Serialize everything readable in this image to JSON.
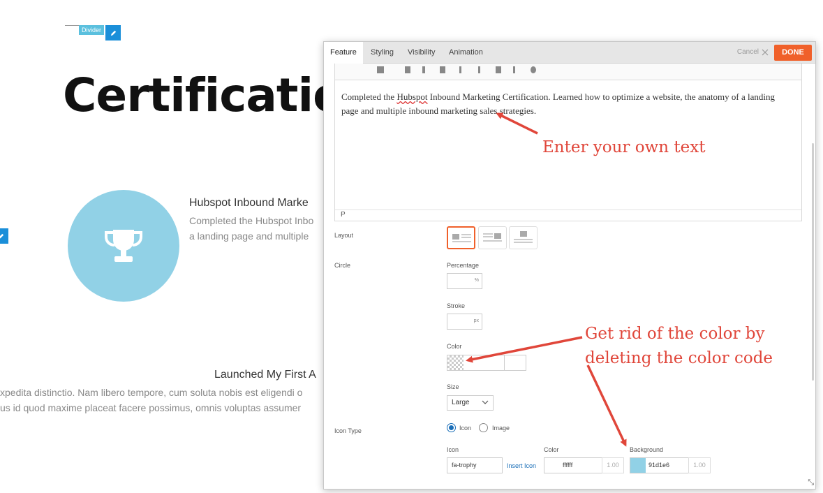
{
  "page": {
    "divider_tag": "Divider",
    "title": "Certificatio",
    "feature_title": "Hubspot Inbound Marke",
    "feature_desc_1": "Completed the Hubspot Inbo",
    "feature_desc_2": "a landing page and multiple",
    "launch_title": "Launched My First A",
    "lorem_1": "xpedita distinctio. Nam libero tempore, cum soluta nobis est eligendi o",
    "lorem_2": "us id quod maxime placeat facere possimus, omnis voluptas assumer",
    "circle_color": "#91d1e6",
    "trophy_icon": "trophy-icon"
  },
  "dialog": {
    "tabs": [
      "Feature",
      "Styling",
      "Visibility",
      "Animation"
    ],
    "cancel": "Cancel",
    "done": "DONE",
    "editor": {
      "text_before": "Completed the ",
      "text_spell": "Hubspot",
      "text_after": " Inbound Marketing Certification. Learned how to optimize a website, the anatomy of a landing page and multiple inbound marketing sales strategies.",
      "status": "P"
    },
    "layout_label": "Layout",
    "circle_label": "Circle",
    "percentage_label": "Percentage",
    "percentage_unit": "%",
    "stroke_label": "Stroke",
    "stroke_unit": "px",
    "color_label": "Color",
    "size_label": "Size",
    "size_value": "Large",
    "icon_type_label": "Icon Type",
    "icon_type_options": [
      "Icon",
      "Image"
    ],
    "icon_label": "Icon",
    "icon_value": "fa-trophy",
    "insert_icon": "Insert Icon",
    "icon_color_label": "Color",
    "icon_color_value": "ffffff",
    "icon_color_opacity": "1.00",
    "background_label": "Background",
    "background_value": "91d1e6",
    "background_opacity": "1.00",
    "accent": "#f0602a"
  },
  "annotations": {
    "text1": "Enter your own text",
    "text2_line1": "Get rid of the color by",
    "text2_line2": "deleting the color code",
    "color": "#e0463a"
  }
}
